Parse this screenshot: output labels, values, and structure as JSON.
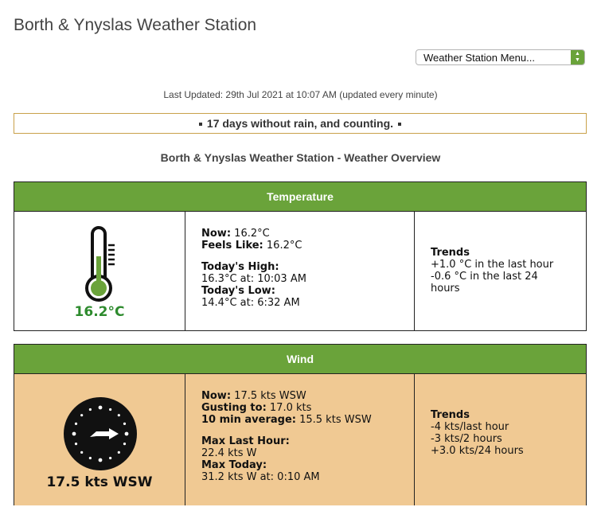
{
  "header": {
    "title": "Borth & Ynyslas Weather Station",
    "menu_label": "Weather Station Menu..."
  },
  "last_updated": "Last Updated: 29th Jul 2021 at 10:07 AM (updated every minute)",
  "rain_notice": "17 days without rain, and counting.",
  "overview_title": "Borth & Ynyslas Weather Station - Weather Overview",
  "colors": {
    "accent_green": "#6aa33a",
    "wind_bg": "#f0c993",
    "rain_border": "#c9a14a",
    "temp_text": "#2e8b2e"
  },
  "temperature": {
    "header": "Temperature",
    "icon": "thermometer-icon",
    "big_value": "16.2°C",
    "now_label": "Now:",
    "now_value": "16.2°C",
    "feels_label": "Feels Like:",
    "feels_value": "16.2°C",
    "high_label": "Today's High:",
    "high_value": "16.3°C at: 10:03 AM",
    "low_label": "Today's Low:",
    "low_value": "14.4°C at: 6:32 AM",
    "trends_label": "Trends",
    "trend_1": "+1.0 °C in the last hour",
    "trend_2": "-0.6 °C in the last 24",
    "trend_3": "hours"
  },
  "wind": {
    "header": "Wind",
    "icon": "wind-compass-icon",
    "big_value": "17.5 kts WSW",
    "now_label": "Now:",
    "now_value": "17.5 kts WSW",
    "gust_label": "Gusting to:",
    "gust_value": "17.0 kts",
    "avg_label": "10 min average:",
    "avg_value": "15.5 kts WSW",
    "max_hour_label": "Max Last Hour:",
    "max_hour_value": "22.4 kts W",
    "max_today_label": "Max Today:",
    "max_today_value": "31.2 kts W at: 0:10 AM",
    "trends_label": "Trends",
    "trend_1": "-4 kts/last hour",
    "trend_2": "-3 kts/2 hours",
    "trend_3": "+3.0 kts/24 hours"
  }
}
